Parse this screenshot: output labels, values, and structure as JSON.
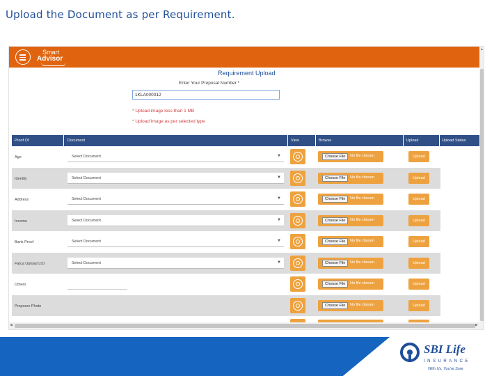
{
  "slide": {
    "title": "Upload the Document as per Requirement."
  },
  "app": {
    "logo_line1": "Smart",
    "logo_line2": "Advisor",
    "page_title": "Requirement Upload",
    "proposal_label": "Enter Your Proposal Number *",
    "proposal_value": "1KLA000012",
    "note1": "* Upload image less than 1 MB",
    "note2": "* Upload Image as per selected type",
    "columns": [
      "Proof Of",
      "Document",
      "View",
      "Browse",
      "Upload",
      "Upload Status"
    ],
    "choose_label": "Choose File",
    "no_file_label": "No file chosen",
    "upload_label": "Upload",
    "select_placeholder": "Select Document",
    "rows": [
      {
        "label": "Age"
      },
      {
        "label": "Identity"
      },
      {
        "label": "Address"
      },
      {
        "label": "Income"
      },
      {
        "label": "Bank Proof"
      },
      {
        "label": "Fatca Upload LIO"
      },
      {
        "label": "Others"
      },
      {
        "label": "Proposer Photo"
      }
    ]
  },
  "footer": {
    "brand_name": "SBI Life",
    "brand_sub": "INSURANCE",
    "brand_tag": "With Us, You're Sure",
    "colors": {
      "blue": "#1565c0",
      "brand": "#1f4e9a",
      "orange": "#e0640f",
      "button": "#eea23f"
    }
  }
}
